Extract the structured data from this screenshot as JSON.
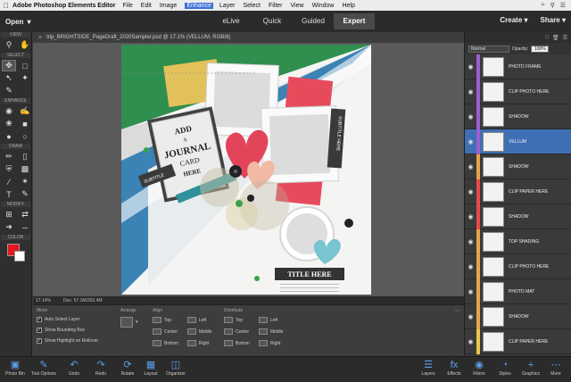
{
  "menubar": {
    "app_name": "Adobe Photoshop Elements Editor",
    "items": [
      "File",
      "Edit",
      "Image",
      "Enhance",
      "Layer",
      "Select",
      "Filter",
      "View",
      "Window",
      "Help"
    ],
    "active": "Enhance"
  },
  "topbar": {
    "open_label": "Open",
    "modes": [
      "eLive",
      "Quick",
      "Guided",
      "Expert"
    ],
    "active_mode": "Expert",
    "create_label": "Create",
    "share_label": "Share"
  },
  "toolbox": {
    "sections": [
      "VIEW",
      "SELECT",
      "ENHANCE",
      "DRAW",
      "MODIFY",
      "COLOR"
    ],
    "fg_color": "#e8141e",
    "bg_color": "#ffffff"
  },
  "document": {
    "tab_title": "trip_BRIGHTSIDE_PageDraft_2020Sampler.psd @ 17.1% (VELLUM, RGB/8)",
    "journal_lines": [
      "ADD",
      "A",
      "JOURNAL",
      "CARD",
      "HERE"
    ],
    "ribbon_left": "SUBTITLE",
    "ribbon_right": "SUBTITLE HERE",
    "title_label": "TITLE HERE"
  },
  "statusbar": {
    "zoom": "17.14%",
    "doc_info": "Doc: 57.1M/352.4M"
  },
  "options": {
    "move_title": "Move",
    "checks": [
      "Auto Select Layer",
      "Show Bounding Box",
      "Show Highlight on Rollover"
    ],
    "arrange_title": "Arrange",
    "align_title": "Align",
    "align_items": [
      "Top",
      "Left",
      "Center",
      "Middle",
      "Bottom",
      "Right"
    ],
    "distribute_title": "Distribute",
    "distribute_items": [
      "Top",
      "Left",
      "Center",
      "Middle",
      "Bottom",
      "Right"
    ]
  },
  "bottombar": {
    "left": [
      "Photo Bin",
      "Tool Options",
      "Undo",
      "Redo",
      "Rotate",
      "Layout",
      "Organizer"
    ],
    "right": [
      "Layers",
      "Effects",
      "Filters",
      "Styles",
      "Graphics",
      "More"
    ]
  },
  "layers": {
    "blend_mode": "Normal",
    "opacity_label": "Opacity:",
    "opacity_value": "100%",
    "items": [
      {
        "name": "PHOTO FRAME",
        "color": "#9a5fcf",
        "selected": false
      },
      {
        "name": "CLIP PHOTO HERE",
        "color": "#9a5fcf",
        "selected": false
      },
      {
        "name": "SHADOW",
        "color": "#9a5fcf",
        "selected": false
      },
      {
        "name": "VELLUM",
        "color": "#9a5fcf",
        "selected": true
      },
      {
        "name": "SHADOW",
        "color": "#e8a24a",
        "selected": false
      },
      {
        "name": "CLIP PAPER HERE",
        "color": "#e84a4a",
        "selected": false
      },
      {
        "name": "SHADOW",
        "color": "#e84a4a",
        "selected": false
      },
      {
        "name": "TOP SHADING",
        "color": "#e8a24a",
        "selected": false
      },
      {
        "name": "CLIP PHOTO HERE",
        "color": "#e8a24a",
        "selected": false
      },
      {
        "name": "PHOTO MAT",
        "color": "#e8a24a",
        "selected": false
      },
      {
        "name": "SHADOW",
        "color": "#e8a24a",
        "selected": false
      },
      {
        "name": "CLIP PAPER HERE",
        "color": "#e8c84a",
        "selected": false
      }
    ]
  }
}
